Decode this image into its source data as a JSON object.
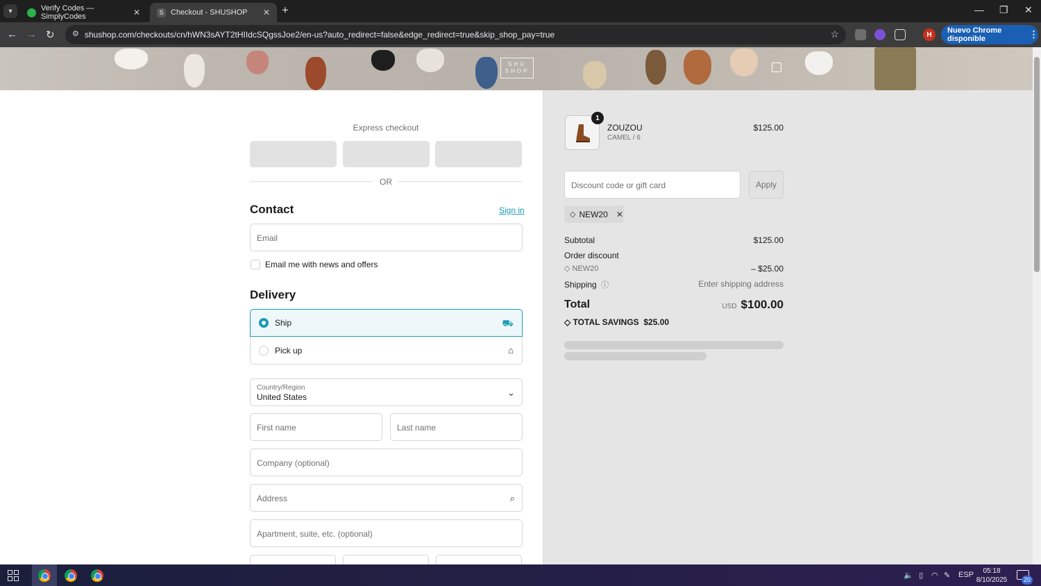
{
  "browser": {
    "tabs": [
      {
        "title": "Verify Codes — SimplyCodes",
        "favicon_color": "#2bb24c",
        "active": false
      },
      {
        "title": "Checkout - SHUSHOP",
        "favicon_color": "#555555",
        "active": true
      }
    ],
    "url": "shushop.com/checkouts/cn/hWN3sAYT2tHIIdcSQgssJoe2/en-us?auto_redirect=false&edge_redirect=true&skip_shop_pay=true",
    "profile_initial": "H",
    "update_label": "Nuevo Chrome disponible"
  },
  "header": {
    "logo_line1": "SHU",
    "logo_line2": "SHOP"
  },
  "checkout": {
    "express_title": "Express checkout",
    "or_label": "OR",
    "contact": {
      "heading": "Contact",
      "signin": "Sign in",
      "email_placeholder": "Email",
      "newsletter_label": "Email me with news and offers",
      "newsletter_checked": false
    },
    "delivery": {
      "heading": "Delivery",
      "options": [
        {
          "label": "Ship",
          "selected": true,
          "icon": "truck-icon"
        },
        {
          "label": "Pick up",
          "selected": false,
          "icon": "store-icon"
        }
      ],
      "country_label": "Country/Region",
      "country_value": "United States",
      "first_name_placeholder": "First name",
      "last_name_placeholder": "Last name",
      "company_placeholder": "Company (optional)",
      "address_placeholder": "Address",
      "apartment_placeholder": "Apartment, suite, etc. (optional)"
    }
  },
  "summary": {
    "product": {
      "name": "ZOUZOU",
      "variant": "CAMEL / 6",
      "price": "$125.00",
      "quantity": "1"
    },
    "discount_placeholder": "Discount code or gift card",
    "apply_label": "Apply",
    "applied_code": "NEW20",
    "subtotal_label": "Subtotal",
    "subtotal_value": "$125.00",
    "order_discount_label": "Order discount",
    "discount_code": "NEW20",
    "discount_value": "– $25.00",
    "shipping_label": "Shipping",
    "shipping_value": "Enter shipping address",
    "total_label": "Total",
    "currency": "USD",
    "total_value": "$100.00",
    "savings_label": "TOTAL SAVINGS",
    "savings_value": "$25.00"
  },
  "taskbar": {
    "language": "ESP",
    "time": "05:18",
    "date": "8/10/2025",
    "notifications": "20"
  },
  "colors": {
    "accent": "#1a9bb5",
    "summary_bg": "#e5e5e5",
    "chrome_update": "#1a5fb4"
  }
}
